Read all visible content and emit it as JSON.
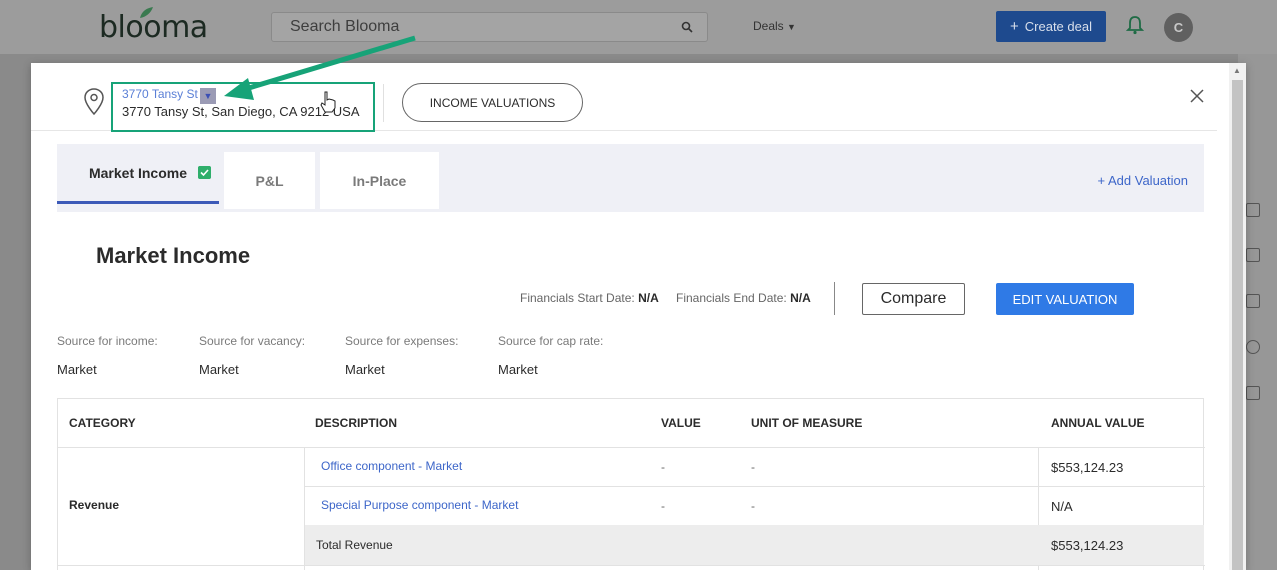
{
  "app": {
    "logo": "blooma",
    "search_placeholder": "Search Blooma",
    "deals_menu": "Deals",
    "create_deal_label": "Create deal",
    "avatar_initial": "C",
    "colors": {
      "primary_blue": "#2f7ae6",
      "accent_green": "#17a378",
      "link_blue": "#3d66c9"
    }
  },
  "modal": {
    "address_short": "3770 Tansy St",
    "address_full": "3770 Tansy St, San Diego, CA 9212  USA",
    "income_valuations_label": "INCOME VALUATIONS",
    "tabs": [
      {
        "label": "Market Income",
        "active": true
      },
      {
        "label": "P&L",
        "active": false
      },
      {
        "label": "In-Place",
        "active": false
      }
    ],
    "add_valuation_label": "+ Add Valuation",
    "section_title": "Market Income",
    "financials_start_label": "Financials Start Date:",
    "financials_start_value": "N/A",
    "financials_end_label": "Financials End Date:",
    "financials_end_value": "N/A",
    "compare_label": "Compare",
    "edit_valuation_label": "EDIT VALUATION",
    "sources": [
      {
        "label": "Source for income:",
        "value": "Market"
      },
      {
        "label": "Source for vacancy:",
        "value": "Market"
      },
      {
        "label": "Source for expenses:",
        "value": "Market"
      },
      {
        "label": "Source for cap rate:",
        "value": "Market"
      }
    ],
    "table": {
      "headers": [
        "CATEGORY",
        "DESCRIPTION",
        "VALUE",
        "UNIT OF MEASURE",
        "ANNUAL VALUE"
      ],
      "category": "Revenue",
      "rows": [
        {
          "description": "Office component - Market",
          "value": "-",
          "unit": "-",
          "annual": "$553,124.23"
        },
        {
          "description": "Special Purpose component - Market",
          "value": "-",
          "unit": "-",
          "annual": "N/A"
        }
      ],
      "total_label": "Total Revenue",
      "total_value": "$553,124.23"
    }
  }
}
